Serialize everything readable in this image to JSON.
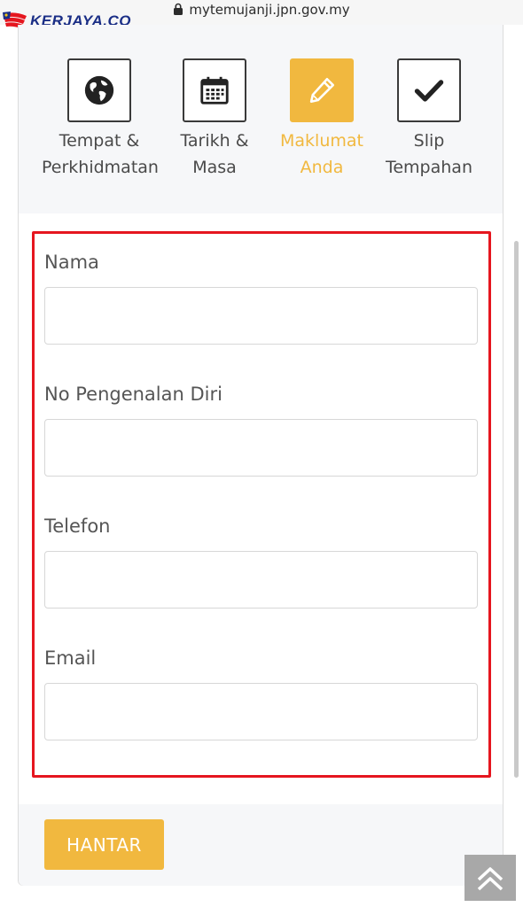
{
  "browser": {
    "url": "mytemujanji.jpn.gov.my"
  },
  "watermark": {
    "text": "KERJAYA.CO"
  },
  "colors": {
    "accent": "#f1b83f",
    "highlight": "#e5161f",
    "text": "#555555"
  },
  "steps": [
    {
      "label": "Tempat &\nPerkhidmatan",
      "icon": "globe-icon",
      "active": false
    },
    {
      "label": "Tarikh &\nMasa",
      "icon": "calendar-icon",
      "active": false
    },
    {
      "label": "Maklumat\nAnda",
      "icon": "pencil-icon",
      "active": true
    },
    {
      "label": "Slip\nTempahan",
      "icon": "checkmark-icon",
      "active": false
    }
  ],
  "form": {
    "fields": [
      {
        "label": "Nama",
        "value": ""
      },
      {
        "label": "No Pengenalan Diri",
        "value": ""
      },
      {
        "label": "Telefon",
        "value": ""
      },
      {
        "label": "Email",
        "value": ""
      }
    ],
    "submit_label": "HANTAR"
  },
  "scroll_top": {
    "icon": "double-chevron-up-icon"
  }
}
